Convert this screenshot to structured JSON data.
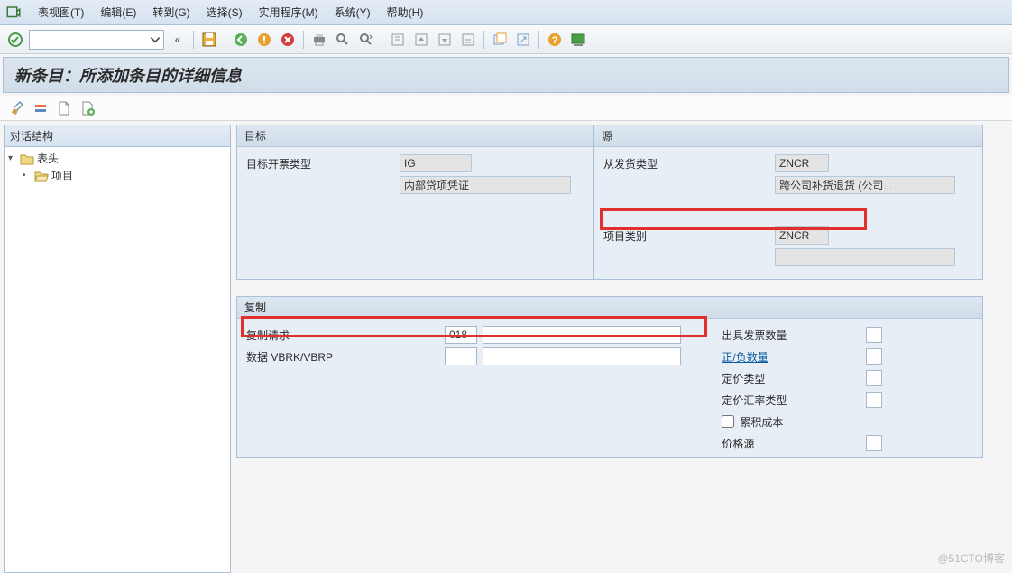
{
  "menubar": {
    "items": [
      "表视图(T)",
      "编辑(E)",
      "转到(G)",
      "选择(S)",
      "实用程序(M)",
      "系统(Y)",
      "帮助(H)"
    ]
  },
  "header": {
    "title": "新条目：所添加条目的详细信息"
  },
  "tree": {
    "header": "对话结构",
    "nodes": [
      {
        "label": "表头",
        "open": true
      },
      {
        "label": "项目",
        "open": true
      }
    ]
  },
  "target": {
    "title": "目标",
    "billing_type_label": "目标开票类型",
    "billing_type_value": "IG",
    "billing_type_desc": "内部贷项凭证"
  },
  "source": {
    "title": "源",
    "delivery_type_label": "从发货类型",
    "delivery_type_value": "ZNCR",
    "delivery_type_desc": "跨公司补货退货 (公司...",
    "item_category_label": "项目类别",
    "item_category_value": "ZNCR"
  },
  "copy": {
    "title": "复制",
    "copy_req_label": "复制请求",
    "copy_req_value": "018",
    "data_label": "数据 VBRK/VBRP",
    "invoice_qty_label": "出具发票数量",
    "posneg_qty_label": "正/负数量",
    "pricing_type_label": "定价类型",
    "pricing_rate_label": "定价汇率类型",
    "cumulated_label": "累积成本",
    "price_source_label": "价格源"
  },
  "watermark": "@51CTO博客"
}
